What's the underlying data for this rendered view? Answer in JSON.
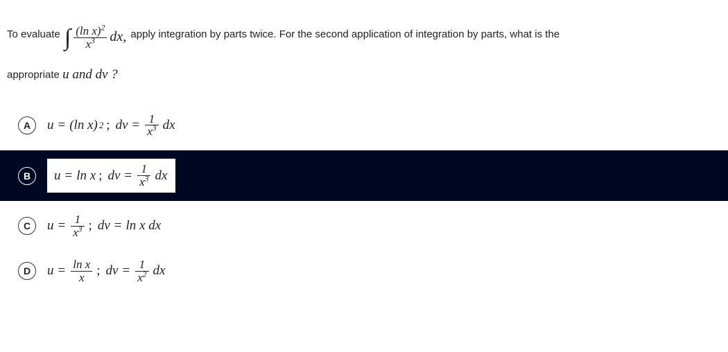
{
  "stem": {
    "pre": "To evaluate",
    "integral_num": "(ln x)",
    "integral_num_sup": "2",
    "integral_den": "x",
    "integral_den_sup": "3",
    "integral_dx": "dx,",
    "mid": "apply integration by parts twice. For the second application of integration by parts, what is the",
    "line2_pre": "appropriate",
    "uanddv": "u and dv ?"
  },
  "options": {
    "A": {
      "letter": "A",
      "lhs1": "u",
      "rhs1_pre": "(ln x)",
      "rhs1_sup": "2",
      "semi": ";",
      "lhs2": "dv",
      "frac_num": "1",
      "frac_den_base": "x",
      "frac_den_sup": "3",
      "dx": "dx"
    },
    "B": {
      "letter": "B",
      "lhs1": "u",
      "rhs1": "ln x",
      "semi": ";",
      "lhs2": "dv",
      "frac_num": "1",
      "frac_den_base": "x",
      "frac_den_sup": "3",
      "dx": "dx"
    },
    "C": {
      "letter": "C",
      "lhs1": "u",
      "frac_num": "1",
      "frac_den_base": "x",
      "frac_den_sup": "3",
      "semi": ";",
      "lhs2": "dv",
      "rhs2": "ln x dx"
    },
    "D": {
      "letter": "D",
      "lhs1": "u",
      "frac1_num": "ln x",
      "frac1_den": "x",
      "semi": ";",
      "lhs2": "dv",
      "frac2_num": "1",
      "frac2_den_base": "x",
      "frac2_den_sup": "2",
      "dx": "dx"
    }
  }
}
